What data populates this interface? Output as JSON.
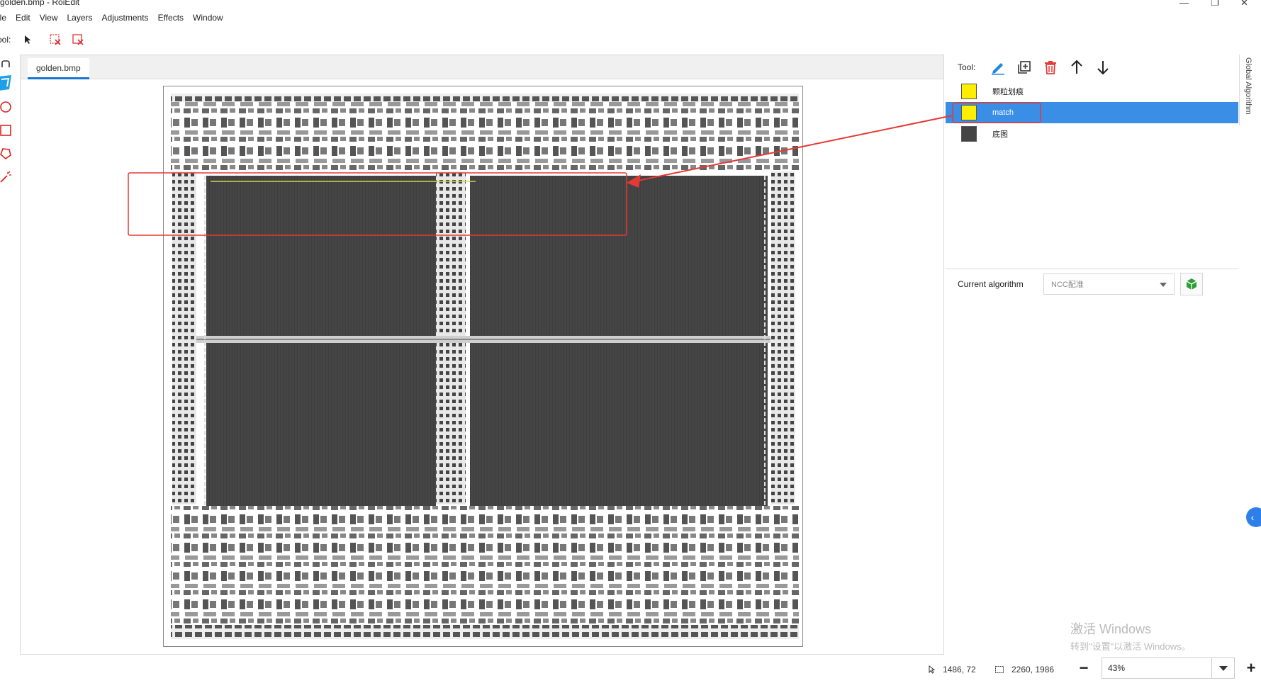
{
  "window": {
    "title": "golden.bmp - RoiEdit",
    "minimize": "—",
    "maximize": "❐",
    "close": "✕"
  },
  "menu": [
    "ile",
    "Edit",
    "View",
    "Layers",
    "Adjustments",
    "Effects",
    "Window"
  ],
  "toolbar": {
    "label": "ool:",
    "tools": [
      "select-arrow-icon",
      "delete-selection-icon",
      "delete-all-icon"
    ]
  },
  "left_tools": [
    "hand-icon",
    "brush-icon",
    "ellipse-icon",
    "rectangle-icon",
    "polygon-icon",
    "magic-wand-icon"
  ],
  "document": {
    "tab_label": "golden.bmp"
  },
  "layers_panel": {
    "tool_label": "Tool:",
    "tool_icons": [
      "edit-icon",
      "add-layer-icon",
      "delete-icon",
      "move-up-icon",
      "move-down-icon"
    ],
    "layers": [
      {
        "name": "颗粒划痕",
        "swatch": "#ffee00",
        "selected": false
      },
      {
        "name": "match",
        "swatch": "#ffee00",
        "selected": true
      },
      {
        "name": "底图",
        "swatch": "#444444",
        "selected": false
      }
    ]
  },
  "algorithm": {
    "label": "Current algorithm",
    "value": "NCC配准"
  },
  "side_tab": "Global Algorithm",
  "status": {
    "cursor": "1486, 72",
    "size": "2260, 1986",
    "zoom": "43%"
  },
  "watermark": {
    "line1": "激活 Windows",
    "line2": "转到\"设置\"以激活 Windows。"
  },
  "colors": {
    "accent": "#3a8ee6",
    "annotation": "#e53935",
    "highlight_yellow": "#ffee00",
    "die_dark": "#444444"
  }
}
